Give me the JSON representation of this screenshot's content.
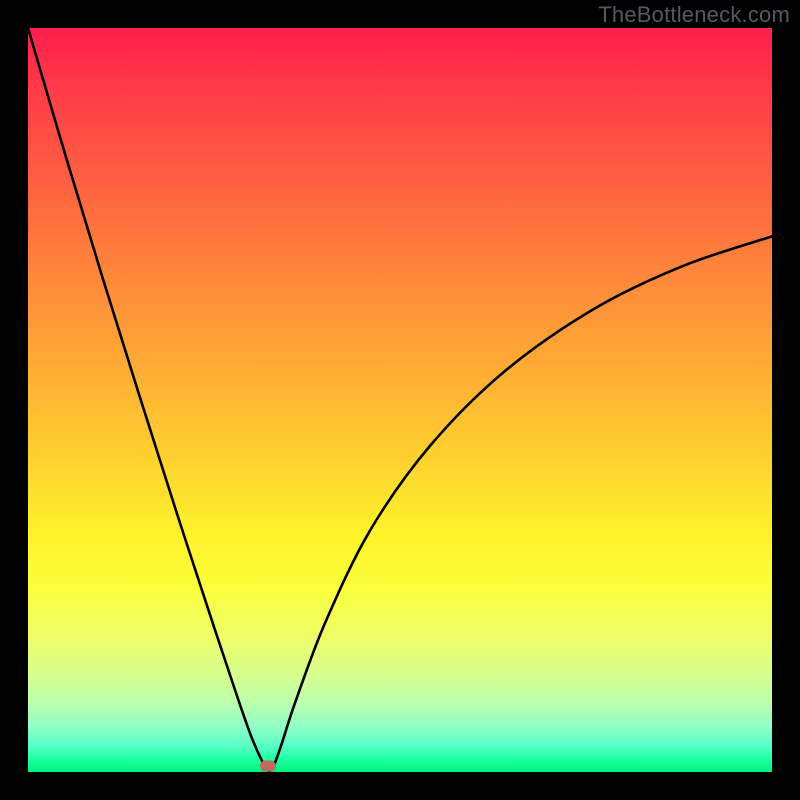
{
  "watermark": "TheBottleneck.com",
  "chart_data": {
    "type": "line",
    "title": "",
    "xlabel": "",
    "ylabel": "",
    "xlim": [
      0,
      100
    ],
    "ylim": [
      0,
      100
    ],
    "series": [
      {
        "name": "bottleneck-curve",
        "x": [
          0,
          5,
          10,
          15,
          20,
          25,
          28,
          30,
          31.5,
          32.3,
          33,
          34,
          36,
          40,
          46,
          54,
          64,
          76,
          88,
          100
        ],
        "y": [
          100,
          83,
          66.5,
          50.5,
          34.8,
          19.5,
          10.5,
          4.8,
          1.4,
          0.2,
          0.8,
          3.5,
          9.6,
          20.2,
          32.5,
          43.8,
          53.8,
          62.2,
          68.0,
          72.0
        ]
      }
    ],
    "marker": {
      "x": 32.3,
      "y": 0.8,
      "color": "#c26a5c"
    },
    "background_gradient": {
      "direction": "vertical",
      "stops": [
        {
          "pos": 0,
          "color": "#ff1e4a"
        },
        {
          "pos": 50,
          "color": "#ffc730"
        },
        {
          "pos": 75,
          "color": "#fbff3a"
        },
        {
          "pos": 100,
          "color": "#00f27e"
        }
      ]
    }
  }
}
